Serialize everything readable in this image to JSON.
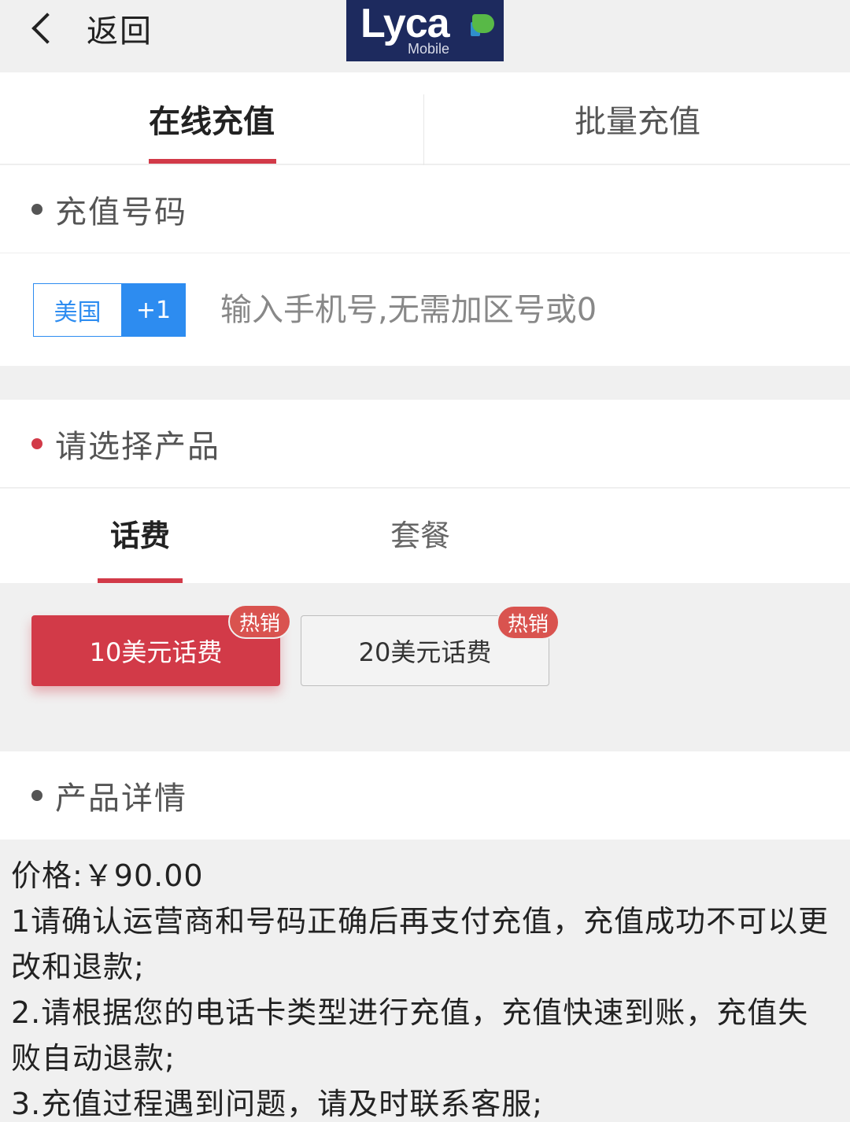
{
  "header": {
    "back_label": "返回",
    "logo_text": "Lyca",
    "logo_sub": "Mobile"
  },
  "main_tabs": [
    {
      "label": "在线充值",
      "active": true
    },
    {
      "label": "批量充值",
      "active": false
    }
  ],
  "recharge_number": {
    "title": "充值号码",
    "country": "美国",
    "code": "+1",
    "placeholder": "输入手机号,无需加区号或0"
  },
  "product_select": {
    "title": "请选择产品",
    "tabs": [
      {
        "label": "话费",
        "active": true
      },
      {
        "label": "套餐",
        "active": false
      }
    ],
    "products": [
      {
        "label": "10美元话费",
        "badge": "热销",
        "selected": true
      },
      {
        "label": "20美元话费",
        "badge": "热销",
        "selected": false
      }
    ]
  },
  "product_details": {
    "title": "产品详情",
    "lines": [
      "价格:￥90.00",
      "1请确认运营商和号码正确后再支付充值，充值成功不可以更改和退款;",
      "2.请根据您的电话卡类型进行充值，充值快速到账，充值失败自动退款;",
      "3.充值过程遇到问题，请及时联系客服;"
    ]
  },
  "colors": {
    "accent_red": "#d23a48",
    "accent_blue": "#2d8cf0",
    "logo_bg": "#1d2a5e"
  }
}
